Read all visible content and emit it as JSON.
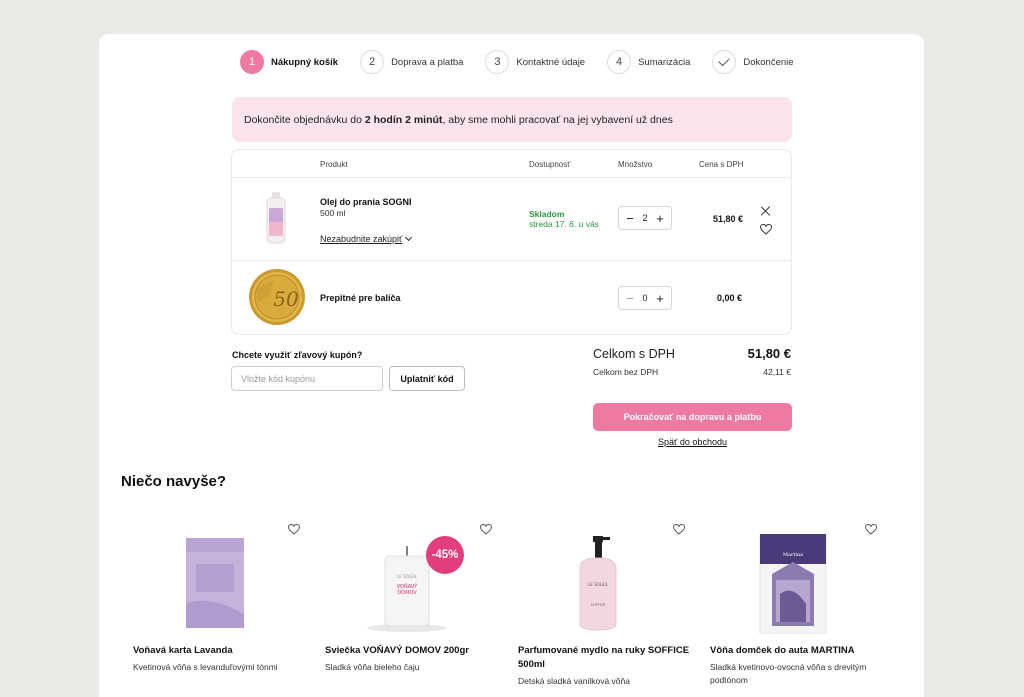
{
  "steps": [
    {
      "num": "1",
      "label": "Nákupný košík"
    },
    {
      "num": "2",
      "label": "Doprava a platba"
    },
    {
      "num": "3",
      "label": "Kontaktné údaje"
    },
    {
      "num": "4",
      "label": "Sumarizácia"
    },
    {
      "num": "",
      "label": "Dokončenie"
    }
  ],
  "banner": {
    "pre": "Dokončite objednávku do ",
    "time": "2 hodín 2 minút",
    "post": ", aby sme mohli pracovať na jej vybavení už dnes"
  },
  "table": {
    "headers": {
      "product": "Produkt",
      "availability": "Dostupnosť",
      "quantity": "Množstvo",
      "price": "Cena s DPH"
    },
    "items": [
      {
        "name": "Olej do prania SOGNI",
        "volume": "500 ml",
        "reminder": "Nezabudnite zakúpiť",
        "stock": "Skladom",
        "delivery": "streda 17. 6. u vás",
        "qty": "2",
        "price": "51,80 €"
      },
      {
        "name": "Prepitné pre balíča",
        "qty": "0",
        "price": "0,00 €"
      }
    ]
  },
  "coupon": {
    "title": "Chcete využiť zľavový kupón?",
    "placeholder": "Vložte kód kupónu",
    "apply": "Uplatniť kód"
  },
  "totals": {
    "total_label": "Celkom s DPH",
    "total_value": "51,80 €",
    "net_label": "Celkom bez DPH",
    "net_value": "42,11 €"
  },
  "actions": {
    "continue": "Pokračovať na dopravu a platbu",
    "back": "Späť do obchodu"
  },
  "upsell": {
    "title": "Niečo navyše?",
    "items": [
      {
        "title": "Voňavá karta Lavanda",
        "desc": "Kvetinová vôňa s levanduľovými tónmi"
      },
      {
        "title": "Sviečka VOŇAVÝ DOMOV 200gr",
        "desc": "Sladká vôňa bieleho čaju",
        "badge": "-45%"
      },
      {
        "title": "Parfumované mydlo na ruky SOFFICE 500ml",
        "desc": "Detská sladká vanilková vôňa"
      },
      {
        "title": "Vôňa domček do auta MARTINA",
        "desc": "Sladká kvetinovo-ovocná vôňa s drevitým podtónom"
      }
    ]
  },
  "colors": {
    "accent": "#ef7aa0",
    "banner_bg": "#fce4ec",
    "stock": "#2a9a3a",
    "badge": "#e23d7c"
  }
}
